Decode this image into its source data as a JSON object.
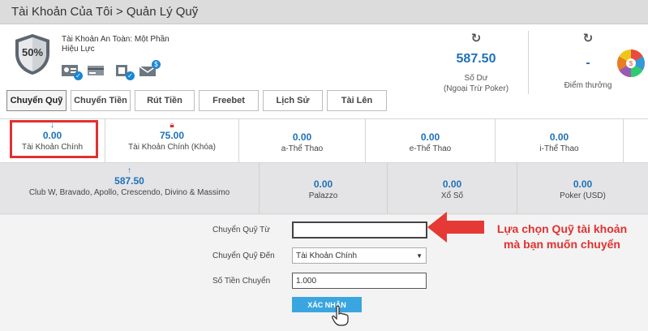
{
  "header": {
    "title": "Tài Khoản Của Tôi > Quản Lý Quỹ"
  },
  "account": {
    "safety_percent": "50%",
    "safety_line1": "Tài Khoản An Toàn: Một Phần",
    "safety_line2": "Hiệu Lực",
    "verification_icons": [
      "id-card-icon",
      "credit-card-icon",
      "phone-icon",
      "email-icon"
    ],
    "balance": {
      "value": "587.50",
      "label_line1": "Số Dư",
      "label_line2": "(Ngoại Trừ Poker)"
    },
    "points": {
      "value": "-",
      "label": "Điểm thưởng"
    }
  },
  "tabs": [
    {
      "label": "Chuyển Quỹ",
      "active": true
    },
    {
      "label": "Chuyển Tiền",
      "active": false
    },
    {
      "label": "Rút Tiền",
      "active": false
    },
    {
      "label": "Freebet",
      "active": false
    },
    {
      "label": "Lịch Sử",
      "active": false
    },
    {
      "label": "Tài Lên",
      "active": false
    }
  ],
  "wallets_row1": [
    {
      "amount": "0.00",
      "name": "Tài Khoản Chính",
      "icon": "down-arrow-icon"
    },
    {
      "amount": "75.00",
      "name": "Tài Khoản Chính (Khóa)",
      "icon": "lock-icon"
    },
    {
      "amount": "0.00",
      "name": "a-Thể Thao"
    },
    {
      "amount": "0.00",
      "name": "e-Thể Thao"
    },
    {
      "amount": "0.00",
      "name": "i-Thể Thao"
    }
  ],
  "wallets_row2": [
    {
      "amount": "587.50",
      "name": "Club W, Bravado, Apollo, Crescendo, Divino & Massimo",
      "icon": "up-arrow-icon"
    },
    {
      "amount": "0.00",
      "name": "Palazzo"
    },
    {
      "amount": "0.00",
      "name": "Xổ Số"
    },
    {
      "amount": "0.00",
      "name": "Poker (USD)"
    }
  ],
  "form": {
    "from_label": "Chuyển Quỹ Từ",
    "from_value": "",
    "to_label": "Chuyển Quỹ Đến",
    "to_value": "Tài Khoản Chính",
    "amount_label": "Số Tiền Chuyển",
    "amount_value": "1.000",
    "confirm_label": "XÁC NHẬN"
  },
  "annotation": {
    "line1": "Lựa chọn Quỹ tài khoản",
    "line2": "mà bạn muốn chuyển"
  },
  "colors": {
    "accent": "#1e71b8",
    "highlight": "#e03131",
    "button": "#3aa6e0"
  }
}
